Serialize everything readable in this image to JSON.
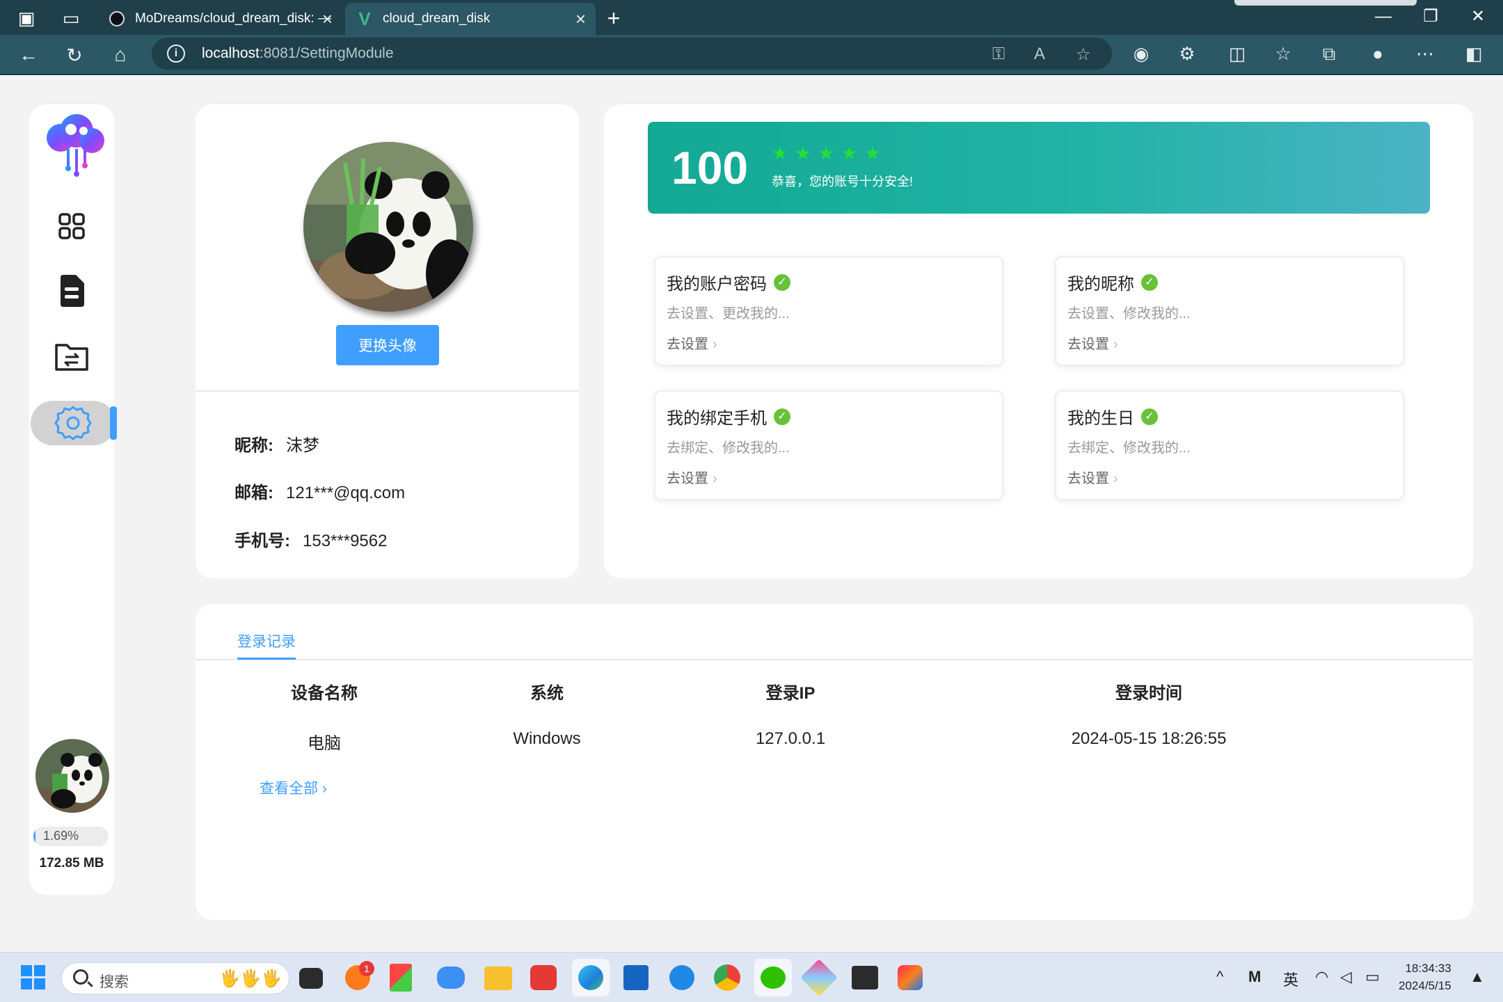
{
  "browser": {
    "tabs": [
      {
        "title": "MoDreams/cloud_dream_disk: —",
        "icon": "github-icon"
      },
      {
        "title": "cloud_dream_disk",
        "icon": "vue-icon"
      }
    ],
    "url_host": "localhost",
    "url_path": ":8081/SettingModule"
  },
  "sidebar": {
    "items": [
      {
        "name": "dashboard",
        "icon": "grid-icon"
      },
      {
        "name": "documents",
        "icon": "document-icon"
      },
      {
        "name": "transfer",
        "icon": "folder-transfer-icon"
      },
      {
        "name": "settings",
        "icon": "gear-icon",
        "active": true
      }
    ],
    "usage_percent_label": "1.69%",
    "usage_fraction": 0.0169,
    "storage_used": "172.85 MB"
  },
  "profile": {
    "change_avatar_label": "更换头像",
    "nickname_label": "昵称:",
    "nickname": "沫梦",
    "email_label": "邮箱:",
    "email": "121***@qq.com",
    "phone_label": "手机号:",
    "phone": "153***9562"
  },
  "security": {
    "score": "100",
    "stars": 5,
    "message": "恭喜，您的账号十分安全!",
    "items": [
      {
        "title": "我的账户密码",
        "desc": "去设置、更改我的...",
        "link": "去设置"
      },
      {
        "title": "我的昵称",
        "desc": "去设置、修改我的...",
        "link": "去设置"
      },
      {
        "title": "我的绑定手机",
        "desc": "去绑定、修改我的...",
        "link": "去设置"
      },
      {
        "title": "我的生日",
        "desc": "去绑定、修改我的...",
        "link": "去设置"
      }
    ]
  },
  "login_records": {
    "tab_label": "登录记录",
    "headers": [
      "设备名称",
      "系统",
      "登录IP",
      "登录时间"
    ],
    "rows": [
      [
        "电脑",
        "Windows",
        "127.0.0.1",
        "2024-05-15 18:26:55"
      ]
    ],
    "view_all": "查看全部"
  },
  "taskbar": {
    "search_placeholder": "搜索",
    "ime": "英",
    "time": "18:34:33",
    "date": "2024/5/15",
    "badge_count": "1"
  },
  "colors": {
    "accent": "#409eff",
    "success": "#67c23a",
    "banner_start": "#13a995",
    "banner_end": "#4bb3c4"
  }
}
